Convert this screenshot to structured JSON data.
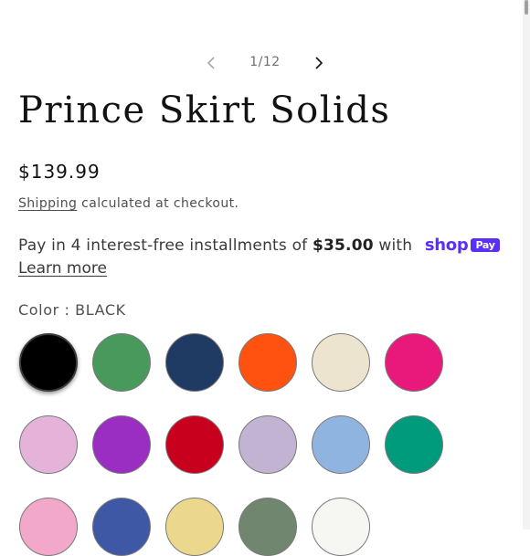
{
  "pager": {
    "count": "1/12"
  },
  "product": {
    "title": "Prince Skirt Solids",
    "price": "$139.99",
    "shipping_link": "Shipping",
    "shipping_rest": " calculated at checkout."
  },
  "installments": {
    "prefix": "Pay in 4 interest-free installments of ",
    "amount": "$35.00",
    "suffix": " with ",
    "shop_brand": "shop",
    "pay_badge": "Pay",
    "learn_more": "Learn more"
  },
  "color": {
    "label": "Color : ",
    "selected": "BLACK",
    "swatches": [
      {
        "color": "#000000",
        "selected": true
      },
      {
        "color": "#4a995c"
      },
      {
        "color": "#1f3a63"
      },
      {
        "color": "#ff5210"
      },
      {
        "color": "#ede4d0"
      },
      {
        "color": "#e8197a"
      },
      {
        "color": "#e5b2d9"
      },
      {
        "color": "#9b2ec2"
      },
      {
        "color": "#c8001d"
      },
      {
        "color": "#c3b3d2"
      },
      {
        "color": "#90b4e0"
      },
      {
        "color": "#009a7c"
      },
      {
        "color": "#f2a8c8"
      },
      {
        "color": "#3f58a6"
      },
      {
        "color": "#ecd88c"
      },
      {
        "color": "#71866e"
      },
      {
        "color": "#f6f6f2"
      }
    ]
  }
}
